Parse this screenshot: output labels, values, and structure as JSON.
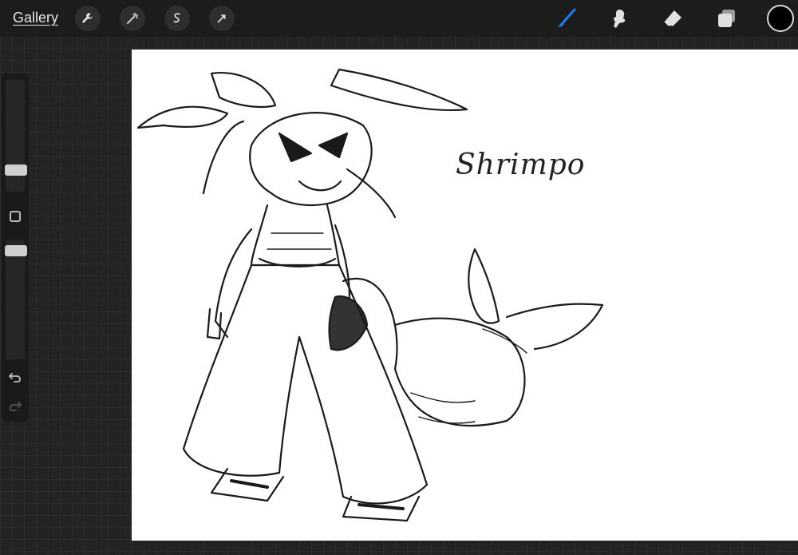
{
  "toolbar": {
    "gallery_label": "Gallery",
    "left_tools": [
      "wrench-icon",
      "magic-wand-icon",
      "selection-icon",
      "transform-arrow-icon"
    ],
    "right_tools": [
      "brush-icon",
      "smudge-icon",
      "eraser-icon",
      "layers-icon"
    ],
    "active_tool": "brush-icon",
    "accent_color": "#1e7cf2",
    "current_color": "#000000"
  },
  "sidebar": {
    "brush_size_level": 0.2,
    "opacity_level": 0.9
  },
  "canvas": {
    "handwritten_text": "Shrimpo",
    "background": "#ffffff"
  }
}
